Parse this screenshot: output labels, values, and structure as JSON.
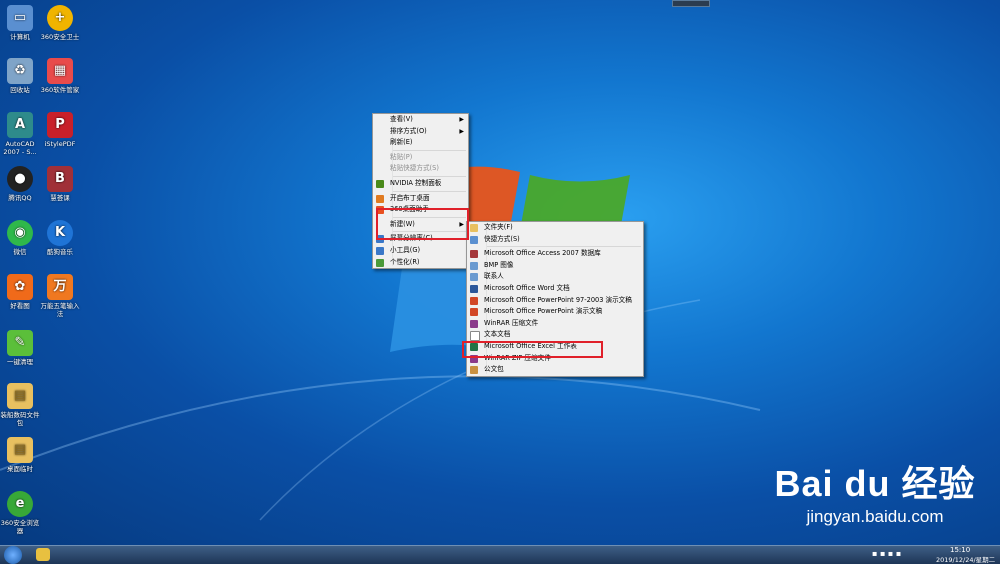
{
  "desktop_icons": [
    {
      "label": "计算机",
      "icon": "computer-icon",
      "color": "#5a8fd0"
    },
    {
      "label": "360安全卫士",
      "icon": "360-safe-icon",
      "color": "#f0b400"
    },
    {
      "label": "回收站",
      "icon": "recycle-bin-icon",
      "color": "#7fa4c8"
    },
    {
      "label": "360软件管家",
      "icon": "360-software-icon",
      "color": "#e84b4b"
    },
    {
      "label": "AutoCAD 2007 - S...",
      "icon": "autocad-icon",
      "color": "#2e8b8b"
    },
    {
      "label": "iStylePDF",
      "icon": "pdf-icon",
      "color": "#c8202a"
    },
    {
      "label": "腾讯QQ",
      "icon": "qq-icon",
      "color": "#222222"
    },
    {
      "label": "慧荟课",
      "icon": "huihui-icon",
      "color": "#a03038"
    },
    {
      "label": "微信",
      "icon": "wechat-icon",
      "color": "#2fb84b"
    },
    {
      "label": "酷狗音乐",
      "icon": "kugou-icon",
      "color": "#1f74d6"
    },
    {
      "label": "好看图",
      "icon": "photo-icon",
      "color": "#f06a1a"
    },
    {
      "label": "万能五笔输入法",
      "icon": "wubi-icon",
      "color": "#f07820"
    },
    {
      "label": "一键清理",
      "icon": "cleanup-icon",
      "color": "#5bbf3a"
    },
    {
      "label": "装船数码文件包",
      "icon": "folder-icon",
      "color": "#e8c060"
    },
    {
      "label": "桌面临时",
      "icon": "folder-icon",
      "color": "#e8c060"
    },
    {
      "label": "360安全浏览器",
      "icon": "360-browser-icon",
      "color": "#38a838"
    }
  ],
  "context_menu": {
    "items": [
      {
        "label": "查看(V)",
        "submenu": true,
        "disabled": false,
        "icon": ""
      },
      {
        "label": "排序方式(O)",
        "submenu": true,
        "disabled": false,
        "icon": ""
      },
      {
        "label": "刷新(E)",
        "submenu": false,
        "disabled": false,
        "icon": ""
      },
      {
        "sep": true
      },
      {
        "label": "粘贴(P)",
        "submenu": false,
        "disabled": true,
        "icon": ""
      },
      {
        "label": "粘贴快捷方式(S)",
        "submenu": false,
        "disabled": true,
        "icon": ""
      },
      {
        "sep": true
      },
      {
        "label": "NVIDIA 控制面板",
        "submenu": false,
        "disabled": false,
        "icon": "#4a8a1a"
      },
      {
        "sep": true
      },
      {
        "label": "开启布丁桌面",
        "submenu": false,
        "disabled": false,
        "icon": "#e07a20"
      },
      {
        "label": "360桌面助手",
        "submenu": false,
        "disabled": false,
        "icon": "#e85020"
      },
      {
        "sep": true
      },
      {
        "label": "新建(W)",
        "submenu": true,
        "disabled": false,
        "icon": ""
      },
      {
        "sep": true
      },
      {
        "label": "屏幕分辨率(C)",
        "submenu": false,
        "disabled": false,
        "icon": "#3a78c8"
      },
      {
        "label": "小工具(G)",
        "submenu": false,
        "disabled": false,
        "icon": "#3a78c8"
      },
      {
        "label": "个性化(R)",
        "submenu": false,
        "disabled": false,
        "icon": "#4a9a3a"
      }
    ]
  },
  "new_submenu": {
    "items": [
      {
        "label": "文件夹(F)",
        "icon": "#e8c060"
      },
      {
        "label": "快捷方式(S)",
        "icon": "#5a8fd0"
      },
      {
        "sep": true
      },
      {
        "label": "Microsoft Office Access 2007 数据库",
        "icon": "#a4373a"
      },
      {
        "label": "BMP 图像",
        "icon": "#6a9ad0"
      },
      {
        "label": "联系人",
        "icon": "#6a9ad0"
      },
      {
        "label": "Microsoft Office Word 文档",
        "icon": "#2b579a"
      },
      {
        "label": "Microsoft Office PowerPoint 97-2003 演示文稿",
        "icon": "#d24726"
      },
      {
        "label": "Microsoft Office PowerPoint 演示文稿",
        "icon": "#d24726"
      },
      {
        "label": "WinRAR 压缩文件",
        "icon": "#8a3a8a"
      },
      {
        "label": "文本文档",
        "icon": "#ffffff"
      },
      {
        "label": "Microsoft Office Excel 工作表",
        "icon": "#217346"
      },
      {
        "label": "WinRAR ZIP 压缩文件",
        "icon": "#8a3a8a"
      },
      {
        "label": "公文包",
        "icon": "#c89040"
      }
    ]
  },
  "taskbar": {
    "time": "15:10",
    "date": "2019/12/24/星期二"
  },
  "watermark": {
    "brand": "Bai du 经验",
    "url": "jingyan.baidu.com"
  },
  "colors": {
    "highlight_box": "#e0202a",
    "menu_bg": "#f0f0f0"
  }
}
